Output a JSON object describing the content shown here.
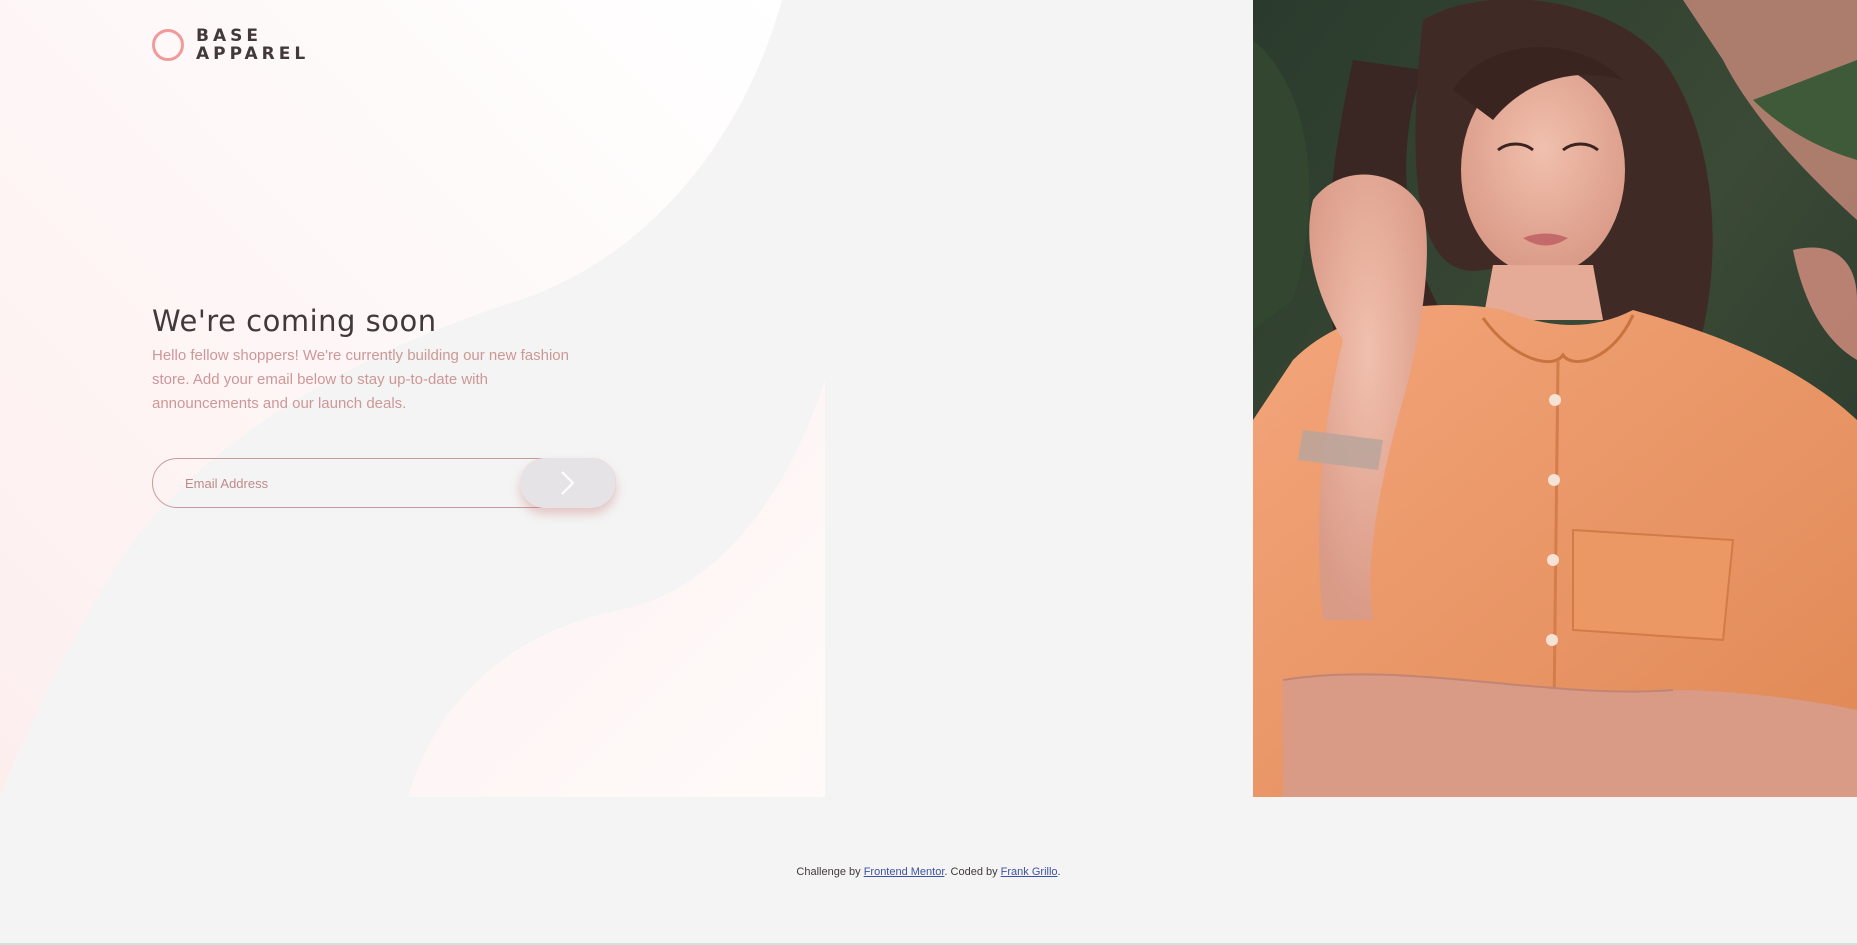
{
  "brand": {
    "line1": "BASE",
    "line2": "APPAREL",
    "accent_color": "#f09a9a"
  },
  "hero": {
    "title": "We're coming soon",
    "description": "Hello fellow shoppers! We're currently building our new fashion store. Add your email below to stay up-to-date with announcements and our launch deals."
  },
  "form": {
    "email_placeholder": "Email Address",
    "submit_icon": "arrow-right-icon"
  },
  "footer": {
    "prefix": "Challenge by ",
    "challenge_link": "Frontend Mentor",
    "middle": ". Coded by ",
    "author_link": "Frank Grillo",
    "suffix": "."
  },
  "photo": {
    "subject": "woman-in-orange-shirt-photo"
  },
  "colors": {
    "background": "#f4f4f4",
    "text_dark": "#423a3a",
    "text_pink": "#ce9797",
    "link": "#3e52a3"
  }
}
